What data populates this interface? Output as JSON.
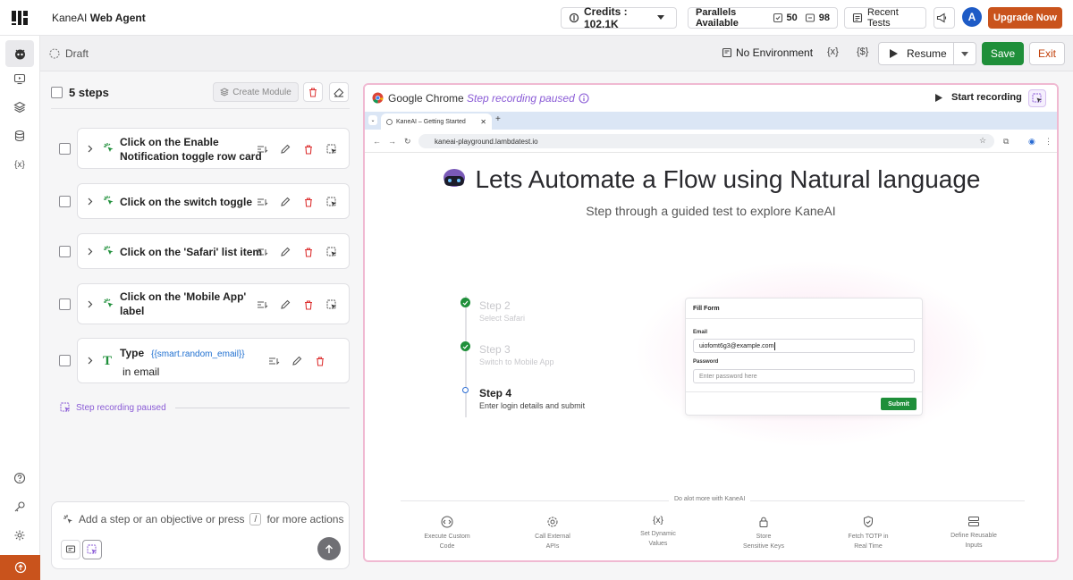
{
  "topbar": {
    "app_name_prefix": "KaneAI",
    "app_name_suffix": "Web Agent",
    "credits_label": "Credits : 102.1K",
    "parallels_label": "Parallels Available",
    "parallels_count_a": "50",
    "parallels_count_b": "98",
    "recent_tests_label": "Recent Tests",
    "avatar_initial": "A",
    "upgrade_label": "Upgrade Now"
  },
  "subbar": {
    "status_label": "Draft",
    "environment_label": "No Environment",
    "variables_label": "{x}",
    "secrets_label": "{$}",
    "resume_label": "Resume",
    "save_label": "Save",
    "exit_label": "Exit"
  },
  "steps_panel": {
    "title": "5 steps",
    "create_module_label": "Create Module",
    "steps": [
      {
        "line1": "Click on the Enable",
        "line2": "Notification toggle row card"
      },
      {
        "line1": "Click on the switch toggle",
        "line2": ""
      },
      {
        "line1": "Click on the 'Safari' list item",
        "line2": ""
      },
      {
        "line1": "Click on the 'Mobile App'",
        "line2": "label"
      },
      {
        "line1": "Type",
        "token": "{{smart.random_email}}",
        "line2": "in email"
      }
    ],
    "paused_label": "Step recording paused",
    "composer_placeholder_a": "Add a step or an objective or press",
    "composer_slash": "/",
    "composer_placeholder_b": "for more actions"
  },
  "browser": {
    "title": "Google Chrome",
    "status": "Step recording paused",
    "start_recording_label": "Start recording",
    "tab_title": "KaneAI – Getting Started",
    "url": "kaneai-playground.lambdatest.io",
    "page": {
      "heading": "Lets Automate a Flow using Natural language",
      "subheading": "Step through a guided test to explore KaneAI",
      "timeline": [
        {
          "title": "Step 2",
          "subtitle": "Select Safari",
          "state": "done"
        },
        {
          "title": "Step 3",
          "subtitle": "Switch to Mobile App",
          "state": "done"
        },
        {
          "title": "Step 4",
          "subtitle": "Enter login details and submit",
          "state": "current"
        }
      ],
      "form": {
        "title": "Fill Form",
        "email_label": "Email",
        "email_value": "uiofomt6g3@example.com",
        "password_label": "Password",
        "password_placeholder": "Enter password here",
        "submit_label": "Submit"
      },
      "more_label": "Do alot more with KaneAI",
      "features": [
        {
          "line1": "Execute Custom",
          "line2": "Code",
          "icon": "code-icon"
        },
        {
          "line1": "Call External",
          "line2": "APIs",
          "icon": "gear-icon"
        },
        {
          "line1": "Set Dynamic",
          "line2": "Values",
          "icon": "variable-icon"
        },
        {
          "line1": "Store",
          "line2": "Sensitive Keys",
          "icon": "lock-icon"
        },
        {
          "line1": "Fetch TOTP in",
          "line2": "Real Time",
          "icon": "shield-icon"
        },
        {
          "line1": "Define Reusable",
          "line2": "Inputs",
          "icon": "inputs-icon"
        }
      ]
    }
  },
  "colors": {
    "accent_orange": "#c9531c",
    "save_green": "#1f8f3a",
    "paused_purple": "#8a5bd6",
    "browser_border_pink": "#f0b9d2"
  }
}
